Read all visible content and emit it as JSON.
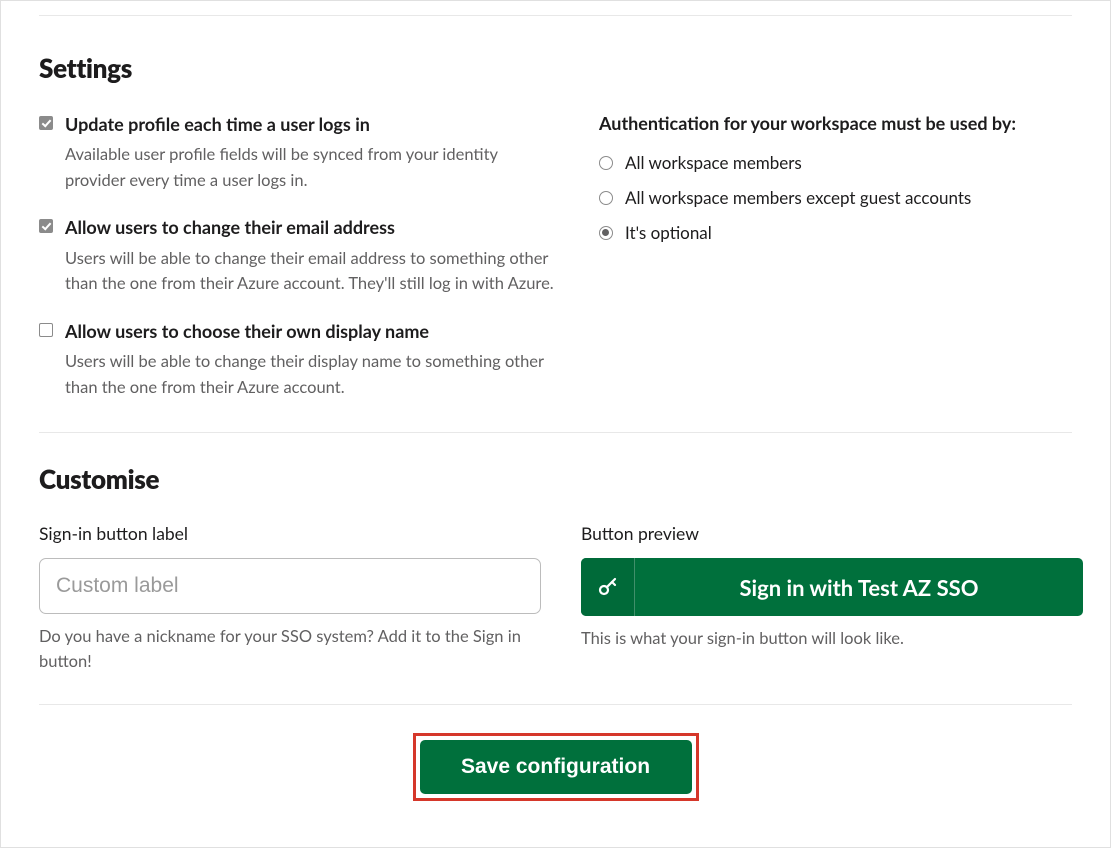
{
  "settings": {
    "heading": "Settings",
    "checkboxes": [
      {
        "title": "Update profile each time a user logs in",
        "desc": "Available user profile fields will be synced from your identity provider every time a user logs in.",
        "checked": true
      },
      {
        "title": "Allow users to change their email address",
        "desc": "Users will be able to change their email address to something other than the one from their Azure account. They'll still log in with Azure.",
        "checked": true
      },
      {
        "title": "Allow users to choose their own display name",
        "desc": "Users will be able to change their display name to something other than the one from their Azure account.",
        "checked": false
      }
    ],
    "auth_heading": "Authentication for your workspace must be used by:",
    "radios": [
      {
        "label": "All workspace members",
        "selected": false
      },
      {
        "label": "All workspace members except guest accounts",
        "selected": false
      },
      {
        "label": "It's optional",
        "selected": true
      }
    ]
  },
  "customise": {
    "heading": "Customise",
    "signin_label": "Sign-in button label",
    "signin_placeholder": "Custom label",
    "signin_hint": "Do you have a nickname for your SSO system? Add it to the Sign in button!",
    "preview_label": "Button preview",
    "preview_button_text": "Sign in with Test AZ SSO",
    "preview_hint": "This is what your sign-in button will look like."
  },
  "save_button": "Save configuration"
}
